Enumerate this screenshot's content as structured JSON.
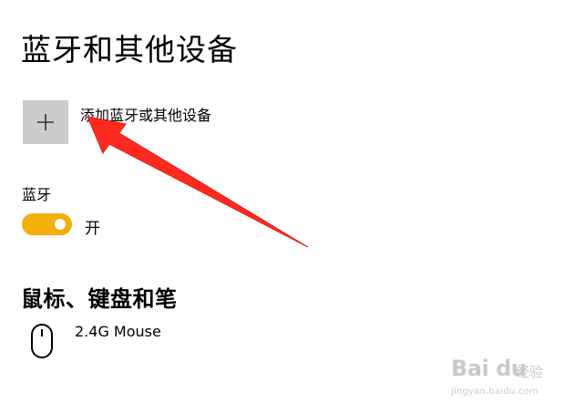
{
  "page": {
    "title": "蓝牙和其他设备"
  },
  "add_device": {
    "icon": "plus-icon",
    "label": "添加蓝牙或其他设备",
    "tile_color": "#cccccc"
  },
  "bluetooth": {
    "label": "蓝牙",
    "toggle_on": true,
    "toggle_state_text": "开",
    "toggle_color": "#f3ae0c"
  },
  "mouse_keyboard_pen": {
    "heading": "鼠标、键盘和笔",
    "devices": [
      {
        "icon": "mouse-icon",
        "name": "2.4G Mouse"
      }
    ]
  },
  "annotation": {
    "arrow_color": "#ff2a1f"
  },
  "watermark": {
    "brand": "Bai du",
    "brand_cn": "经验",
    "url": "jingyan.baidu.com"
  }
}
